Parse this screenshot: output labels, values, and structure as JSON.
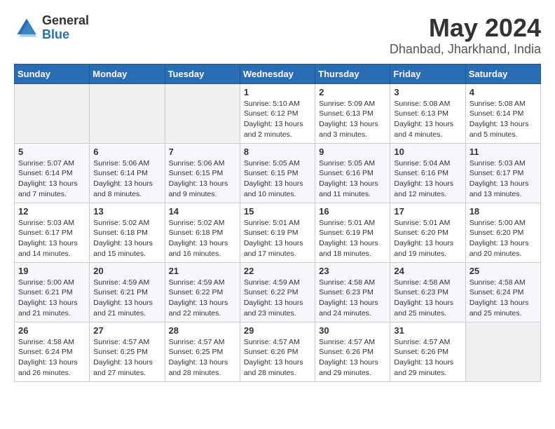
{
  "logo": {
    "general": "General",
    "blue": "Blue"
  },
  "title": "May 2024",
  "subtitle": "Dhanbad, Jharkhand, India",
  "weekdays": [
    "Sunday",
    "Monday",
    "Tuesday",
    "Wednesday",
    "Thursday",
    "Friday",
    "Saturday"
  ],
  "weeks": [
    [
      {
        "day": "",
        "info": ""
      },
      {
        "day": "",
        "info": ""
      },
      {
        "day": "",
        "info": ""
      },
      {
        "day": "1",
        "info": "Sunrise: 5:10 AM\nSunset: 6:12 PM\nDaylight: 13 hours and 2 minutes."
      },
      {
        "day": "2",
        "info": "Sunrise: 5:09 AM\nSunset: 6:13 PM\nDaylight: 13 hours and 3 minutes."
      },
      {
        "day": "3",
        "info": "Sunrise: 5:08 AM\nSunset: 6:13 PM\nDaylight: 13 hours and 4 minutes."
      },
      {
        "day": "4",
        "info": "Sunrise: 5:08 AM\nSunset: 6:14 PM\nDaylight: 13 hours and 5 minutes."
      }
    ],
    [
      {
        "day": "5",
        "info": "Sunrise: 5:07 AM\nSunset: 6:14 PM\nDaylight: 13 hours and 7 minutes."
      },
      {
        "day": "6",
        "info": "Sunrise: 5:06 AM\nSunset: 6:14 PM\nDaylight: 13 hours and 8 minutes."
      },
      {
        "day": "7",
        "info": "Sunrise: 5:06 AM\nSunset: 6:15 PM\nDaylight: 13 hours and 9 minutes."
      },
      {
        "day": "8",
        "info": "Sunrise: 5:05 AM\nSunset: 6:15 PM\nDaylight: 13 hours and 10 minutes."
      },
      {
        "day": "9",
        "info": "Sunrise: 5:05 AM\nSunset: 6:16 PM\nDaylight: 13 hours and 11 minutes."
      },
      {
        "day": "10",
        "info": "Sunrise: 5:04 AM\nSunset: 6:16 PM\nDaylight: 13 hours and 12 minutes."
      },
      {
        "day": "11",
        "info": "Sunrise: 5:03 AM\nSunset: 6:17 PM\nDaylight: 13 hours and 13 minutes."
      }
    ],
    [
      {
        "day": "12",
        "info": "Sunrise: 5:03 AM\nSunset: 6:17 PM\nDaylight: 13 hours and 14 minutes."
      },
      {
        "day": "13",
        "info": "Sunrise: 5:02 AM\nSunset: 6:18 PM\nDaylight: 13 hours and 15 minutes."
      },
      {
        "day": "14",
        "info": "Sunrise: 5:02 AM\nSunset: 6:18 PM\nDaylight: 13 hours and 16 minutes."
      },
      {
        "day": "15",
        "info": "Sunrise: 5:01 AM\nSunset: 6:19 PM\nDaylight: 13 hours and 17 minutes."
      },
      {
        "day": "16",
        "info": "Sunrise: 5:01 AM\nSunset: 6:19 PM\nDaylight: 13 hours and 18 minutes."
      },
      {
        "day": "17",
        "info": "Sunrise: 5:01 AM\nSunset: 6:20 PM\nDaylight: 13 hours and 19 minutes."
      },
      {
        "day": "18",
        "info": "Sunrise: 5:00 AM\nSunset: 6:20 PM\nDaylight: 13 hours and 20 minutes."
      }
    ],
    [
      {
        "day": "19",
        "info": "Sunrise: 5:00 AM\nSunset: 6:21 PM\nDaylight: 13 hours and 21 minutes."
      },
      {
        "day": "20",
        "info": "Sunrise: 4:59 AM\nSunset: 6:21 PM\nDaylight: 13 hours and 21 minutes."
      },
      {
        "day": "21",
        "info": "Sunrise: 4:59 AM\nSunset: 6:22 PM\nDaylight: 13 hours and 22 minutes."
      },
      {
        "day": "22",
        "info": "Sunrise: 4:59 AM\nSunset: 6:22 PM\nDaylight: 13 hours and 23 minutes."
      },
      {
        "day": "23",
        "info": "Sunrise: 4:58 AM\nSunset: 6:23 PM\nDaylight: 13 hours and 24 minutes."
      },
      {
        "day": "24",
        "info": "Sunrise: 4:58 AM\nSunset: 6:23 PM\nDaylight: 13 hours and 25 minutes."
      },
      {
        "day": "25",
        "info": "Sunrise: 4:58 AM\nSunset: 6:24 PM\nDaylight: 13 hours and 25 minutes."
      }
    ],
    [
      {
        "day": "26",
        "info": "Sunrise: 4:58 AM\nSunset: 6:24 PM\nDaylight: 13 hours and 26 minutes."
      },
      {
        "day": "27",
        "info": "Sunrise: 4:57 AM\nSunset: 6:25 PM\nDaylight: 13 hours and 27 minutes."
      },
      {
        "day": "28",
        "info": "Sunrise: 4:57 AM\nSunset: 6:25 PM\nDaylight: 13 hours and 28 minutes."
      },
      {
        "day": "29",
        "info": "Sunrise: 4:57 AM\nSunset: 6:26 PM\nDaylight: 13 hours and 28 minutes."
      },
      {
        "day": "30",
        "info": "Sunrise: 4:57 AM\nSunset: 6:26 PM\nDaylight: 13 hours and 29 minutes."
      },
      {
        "day": "31",
        "info": "Sunrise: 4:57 AM\nSunset: 6:26 PM\nDaylight: 13 hours and 29 minutes."
      },
      {
        "day": "",
        "info": ""
      }
    ]
  ]
}
